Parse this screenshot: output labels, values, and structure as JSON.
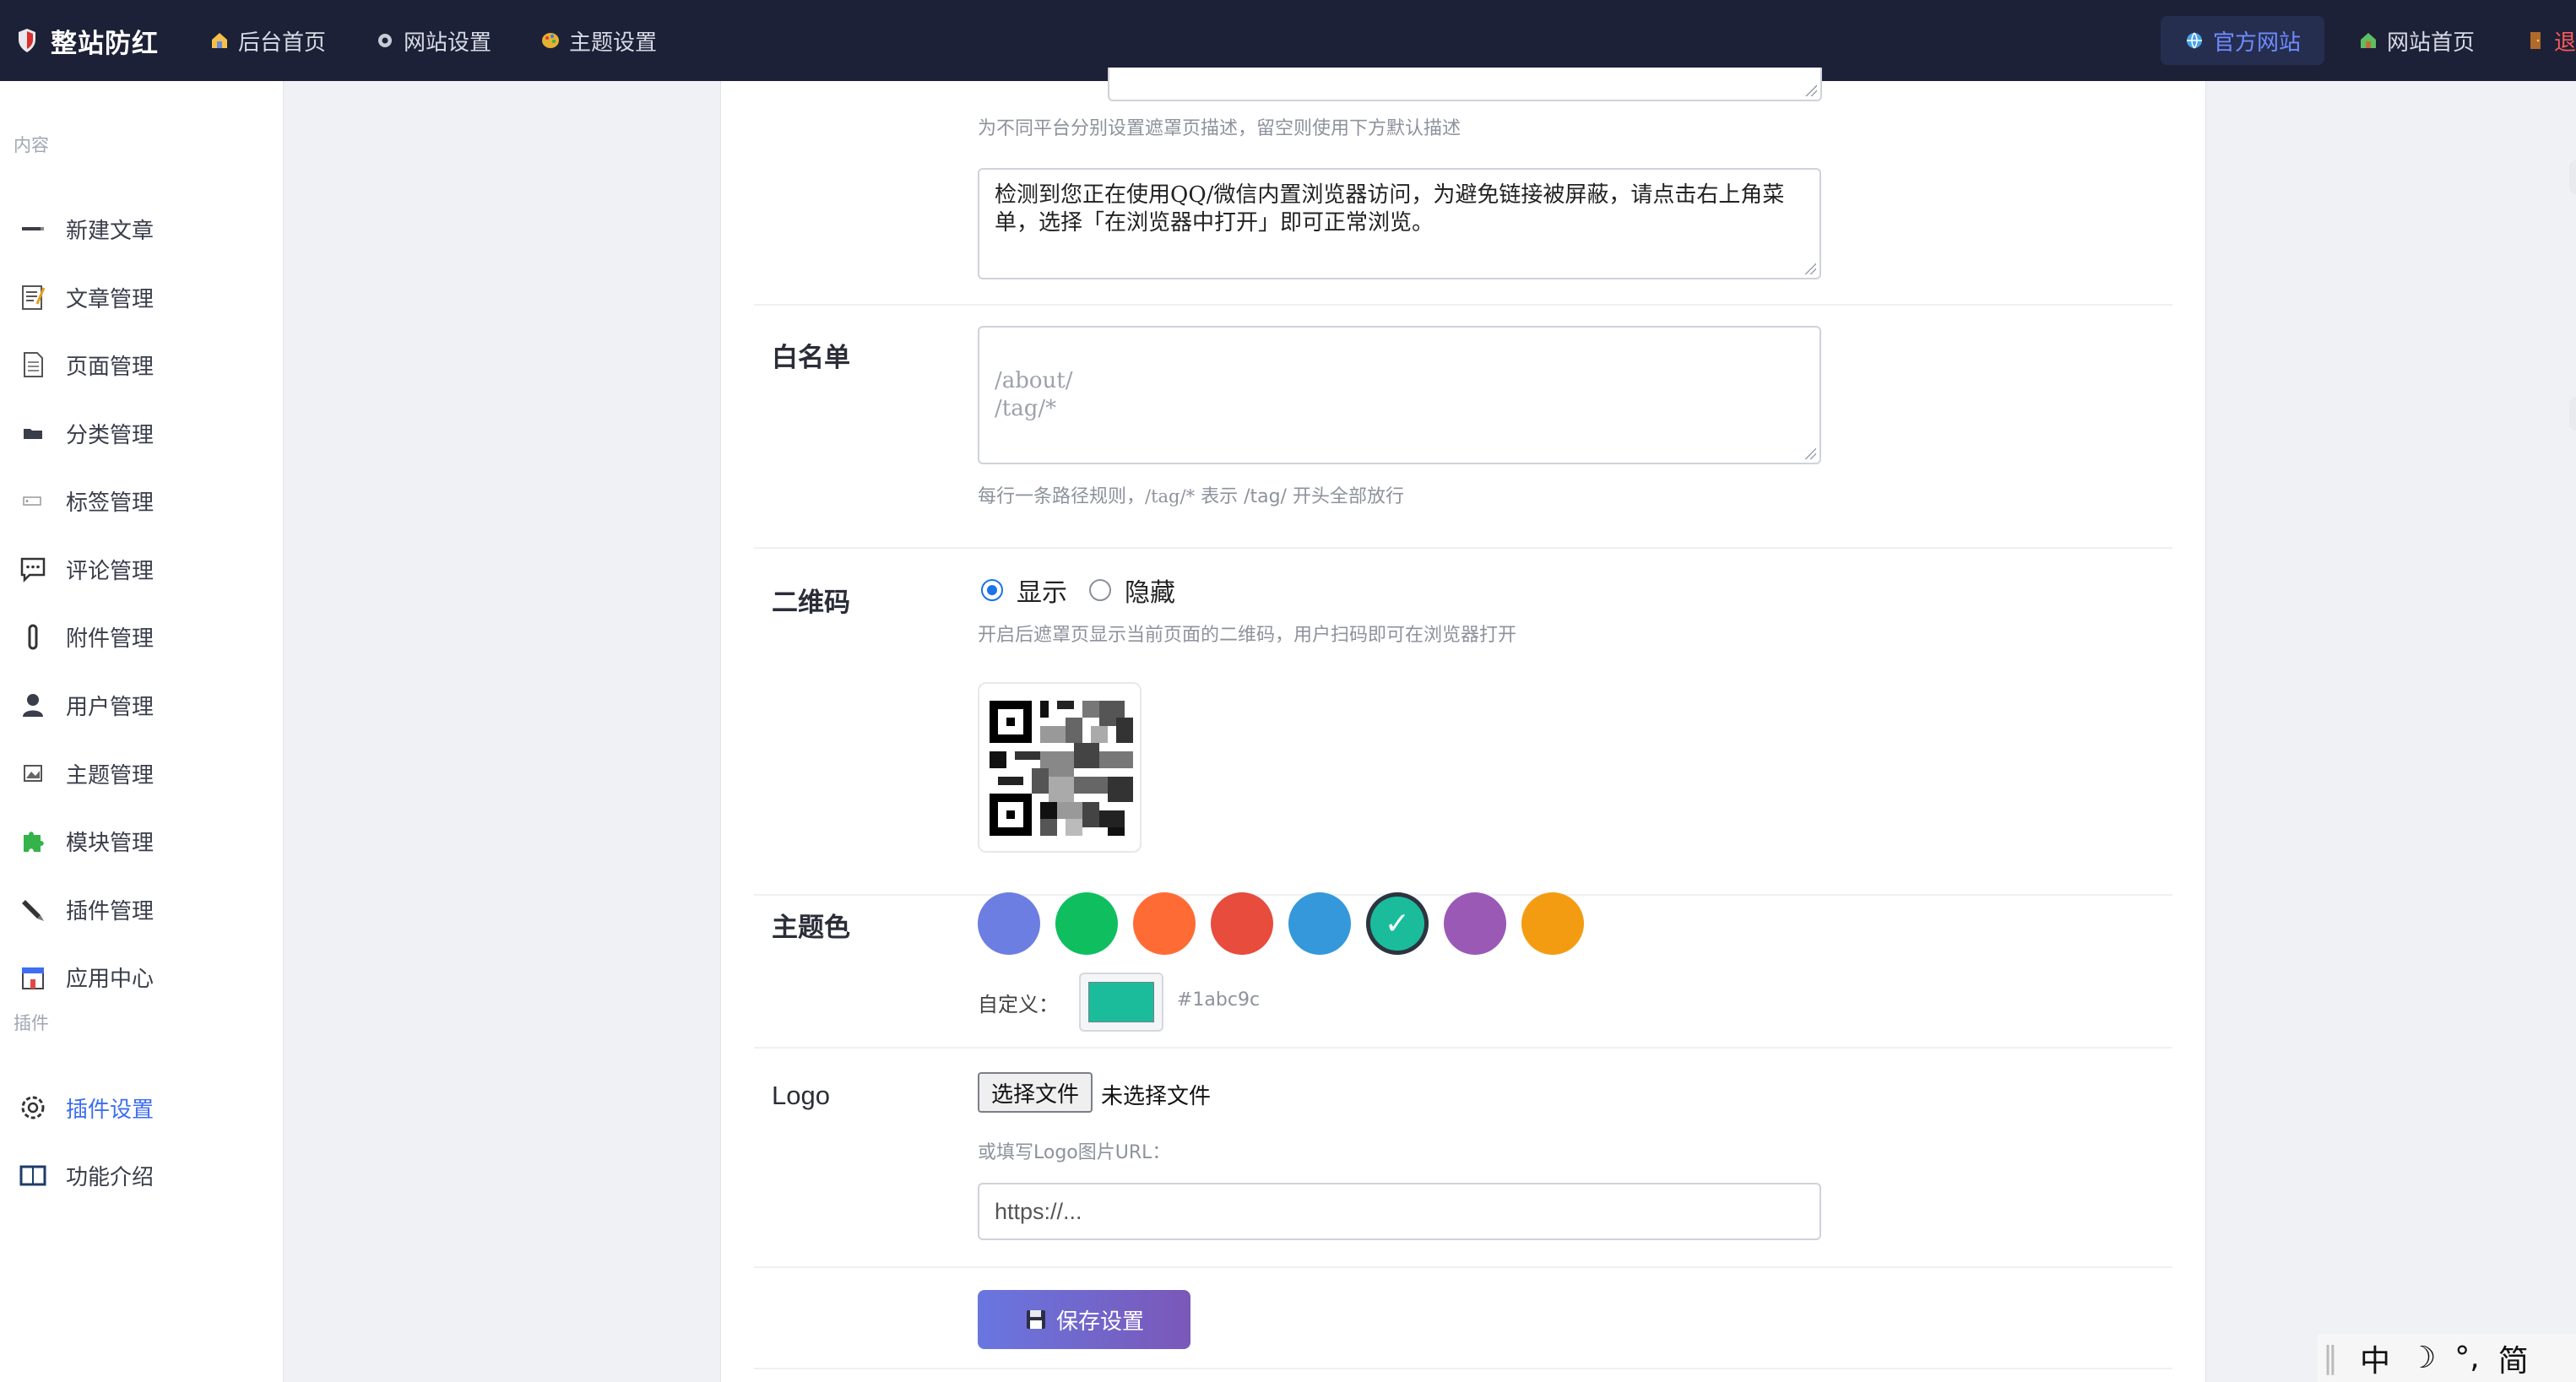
{
  "topbar": {
    "brand": "整站防红",
    "nav": [
      {
        "label": "后台首页",
        "icon": "house-icon"
      },
      {
        "label": "网站设置",
        "icon": "gear-icon"
      },
      {
        "label": "主题设置",
        "icon": "palette-icon"
      }
    ],
    "right": {
      "official": "官方网站",
      "home": "网站首页",
      "logout": "退出"
    }
  },
  "sidebar": {
    "section_content": "内容",
    "section_plugins": "插件",
    "items": [
      {
        "label": "新建文章",
        "icon": "pen-icon"
      },
      {
        "label": "文章管理",
        "icon": "memo-icon"
      },
      {
        "label": "页面管理",
        "icon": "page-icon"
      },
      {
        "label": "分类管理",
        "icon": "folder-icon"
      },
      {
        "label": "标签管理",
        "icon": "tag-icon"
      },
      {
        "label": "评论管理",
        "icon": "comment-icon"
      },
      {
        "label": "附件管理",
        "icon": "paperclip-icon"
      },
      {
        "label": "用户管理",
        "icon": "user-icon"
      },
      {
        "label": "主题管理",
        "icon": "picture-icon"
      },
      {
        "label": "模块管理",
        "icon": "puzzle-icon"
      },
      {
        "label": "插件管理",
        "icon": "brush-icon"
      },
      {
        "label": "应用中心",
        "icon": "store-icon"
      },
      {
        "label": "插件设置",
        "icon": "settings-icon"
      },
      {
        "label": "功能介绍",
        "icon": "book-icon"
      }
    ],
    "active": "插件设置"
  },
  "form": {
    "platform_hint": "为不同平台分别设置遮罩页描述，留空则使用下方默认描述",
    "default_desc": "检测到您正在使用QQ/微信内置浏览器访问，为避免链接被屏蔽，请点击右上角菜单，选择「在浏览器中打开」即可正常浏览。",
    "whitelist": {
      "label": "白名单",
      "placeholder": "/about/\n/tag/*",
      "hint_pre": "每行一条路径规则，",
      "hint_code": "/tag/*",
      "hint_post": " 表示 /tag/ 开头全部放行"
    },
    "qrcode": {
      "label": "二维码",
      "show": "显示",
      "hide": "隐藏",
      "selected": "显示",
      "hint": "开启后遮罩页显示当前页面的二维码，用户扫码即可在浏览器打开"
    },
    "theme_color": {
      "label": "主题色",
      "swatches": [
        "#6c7ee1",
        "#0fbf5f",
        "#ff6b35",
        "#e74c3c",
        "#3498db",
        "#1abc9c",
        "#9b59b6",
        "#f39c12"
      ],
      "selected": "#1abc9c",
      "check": "✓",
      "custom_label": "自定义：",
      "custom_value": "#1abc9c"
    },
    "logo": {
      "label": "Logo",
      "choose_file": "选择文件",
      "no_file": "未选择文件",
      "url_hint": "或填写Logo图片URL：",
      "url_placeholder": "https://..."
    },
    "save": "保存设置"
  },
  "ime": [
    "中",
    "☽",
    "°,",
    "简"
  ]
}
